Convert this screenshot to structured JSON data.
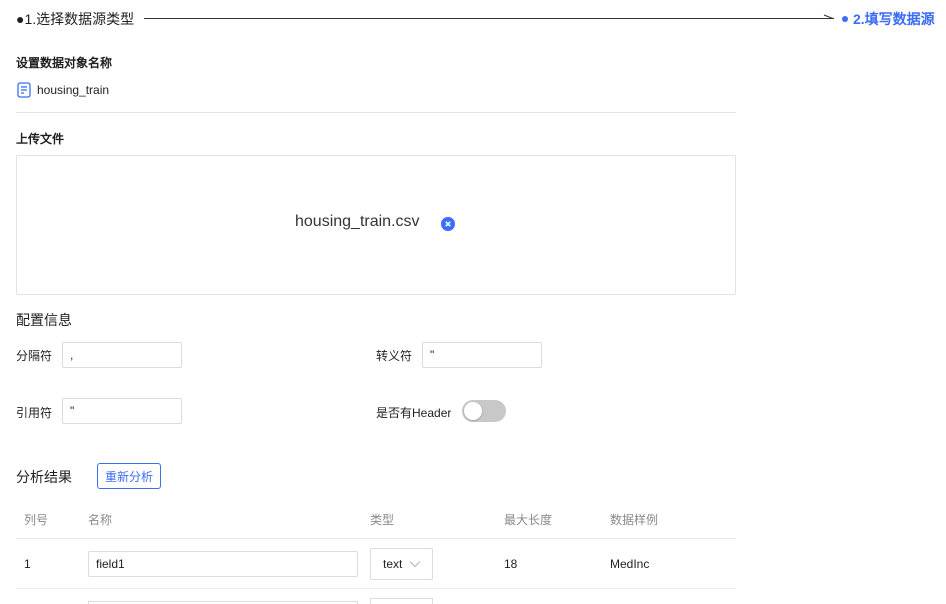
{
  "steps": {
    "step1": "●1.选择数据源类型",
    "step2": "2.填写数据源"
  },
  "object_name": {
    "title": "设置数据对象名称",
    "value": "housing_train"
  },
  "upload": {
    "title": "上传文件",
    "file_name": "housing_train.csv"
  },
  "config": {
    "title": "配置信息",
    "separator_label": "分隔符",
    "separator_value": ",",
    "escape_label": "转义符",
    "escape_value": "\"",
    "quote_label": "引用符",
    "quote_value": "\"",
    "header_label": "是否有Header",
    "header_enabled": false
  },
  "analysis": {
    "title": "分析结果",
    "reanalyze_label": "重新分析",
    "columns": [
      "列号",
      "名称",
      "类型",
      "最大长度",
      "数据样例"
    ],
    "rows": [
      {
        "index": "1",
        "name": "field1",
        "type": "text",
        "max_length": "18",
        "sample": "MedInc"
      }
    ]
  },
  "colors": {
    "accent": "#3b6ef5",
    "toggle_off": "#c8c8c8"
  }
}
